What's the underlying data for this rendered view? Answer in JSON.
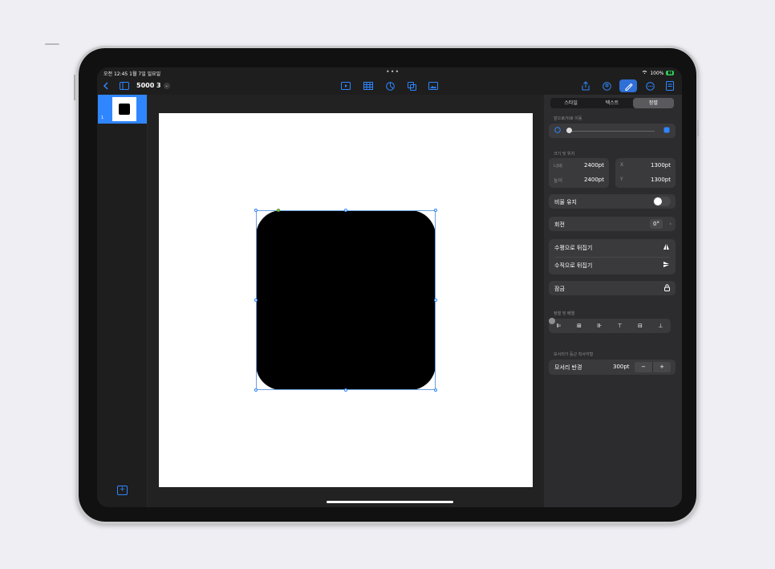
{
  "status_bar": {
    "time": "오전 12:45  1월 7일 일요일",
    "center_dots": "•••",
    "battery": "100%"
  },
  "toolbar": {
    "back_icon": "chevron-left-icon",
    "sidebar_icon": "sidebar-icon",
    "doc_title": "5000 3",
    "title_chevron": "⌄",
    "center_icons": [
      "play-icon",
      "table-icon",
      "chart-icon",
      "shapes-icon",
      "media-icon"
    ],
    "right_icons": [
      "share-icon",
      "collaborate-icon",
      "format-brush-icon",
      "more-icon",
      "document-icon"
    ]
  },
  "sidebar": {
    "slide_number": "1"
  },
  "panel": {
    "tabs": [
      "스타일",
      "텍스트",
      "정렬"
    ],
    "active_tab": "정렬",
    "section_move_label": "앞으로/뒤로 이동",
    "section_size_label": "크기 및 위치",
    "width_label": "너비",
    "width_value": "2400pt",
    "height_label": "높이",
    "height_value": "2400pt",
    "x_label": "X",
    "x_value": "1300pt",
    "y_label": "Y",
    "y_value": "1300pt",
    "keep_ratio_label": "비율 유지",
    "rotate_label": "회전",
    "rotate_value": "0°",
    "flip_h_label": "수평으로 뒤집기",
    "flip_v_label": "수직으로 뒤집기",
    "lock_label": "잠금",
    "section_align_label": "정렬 및 배열",
    "section_corner_label": "모서리가 둥근 직사각형",
    "corner_radius_label": "모서리 반경",
    "corner_radius_value": "300pt",
    "minus": "−",
    "plus": "+"
  },
  "colors": {
    "accent": "#2f86ff",
    "panel_bg": "#2c2c2e",
    "card_bg": "#3a3a3c"
  }
}
